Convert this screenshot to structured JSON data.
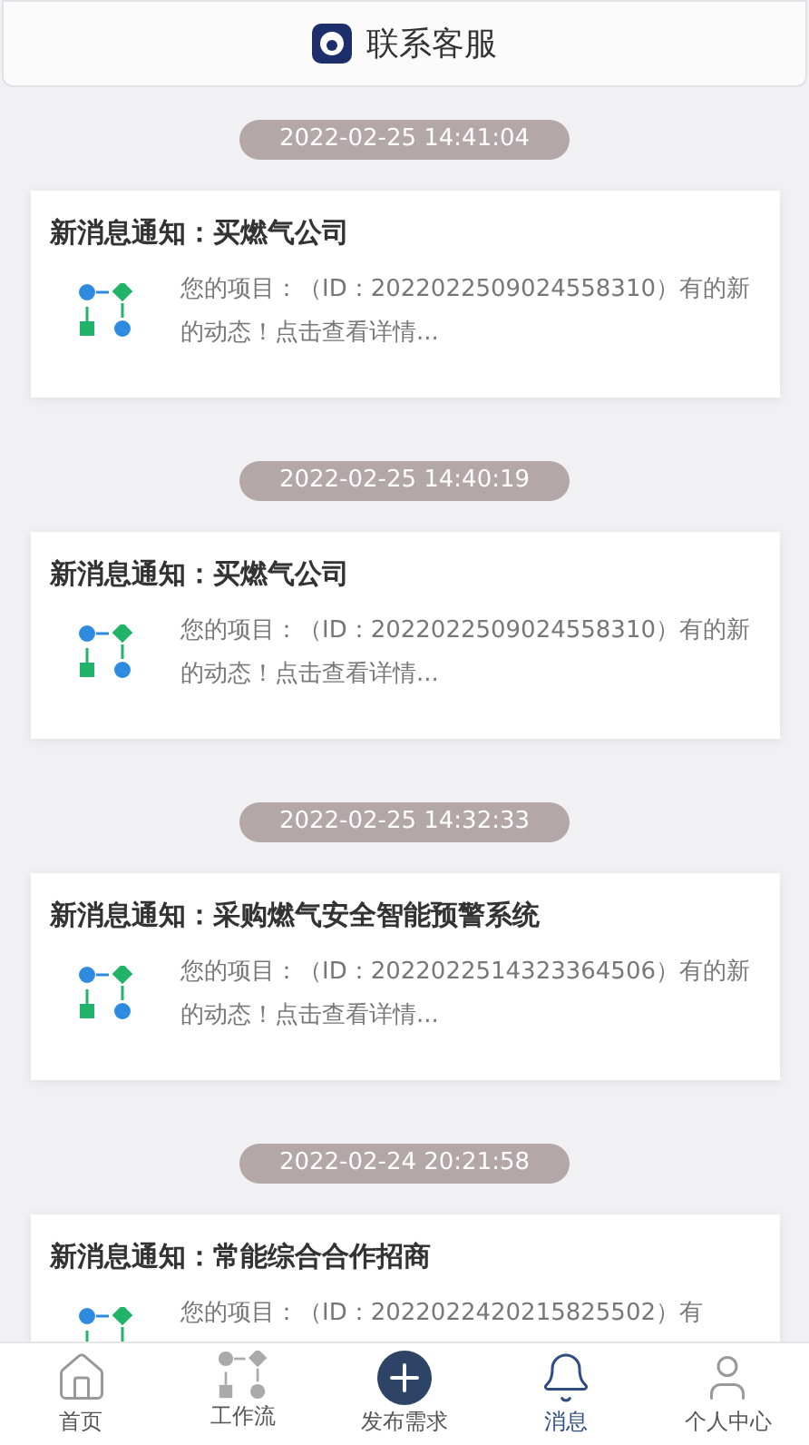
{
  "header": {
    "title": "联系客服"
  },
  "messages": [
    {
      "time": "2022-02-25 14:41:04",
      "title": "新消息通知：买燃气公司",
      "body": "您的项目：（ID：2022022509024558310）有的新的动态！点击查看详情..."
    },
    {
      "time": "2022-02-25 14:40:19",
      "title": "新消息通知：买燃气公司",
      "body": "您的项目：（ID：2022022509024558310）有的新的动态！点击查看详情..."
    },
    {
      "time": "2022-02-25 14:32:33",
      "title": "新消息通知：采购燃气安全智能预警系统",
      "body": "您的项目：（ID：2022022514323364506）有的新的动态！点击查看详情..."
    },
    {
      "time": "2022-02-24 20:21:58",
      "title": "新消息通知：常能综合合作招商",
      "body": "您的项目：（ID：2022022420215825502）有"
    }
  ],
  "nav": [
    {
      "kind": "home",
      "label": "首页",
      "selected": false
    },
    {
      "kind": "workflow",
      "label": "工作流",
      "selected": false
    },
    {
      "kind": "publish",
      "label": "发布需求",
      "selected": false
    },
    {
      "kind": "bell",
      "label": "消息",
      "selected": true
    },
    {
      "kind": "user",
      "label": "个人中心",
      "selected": false
    }
  ]
}
